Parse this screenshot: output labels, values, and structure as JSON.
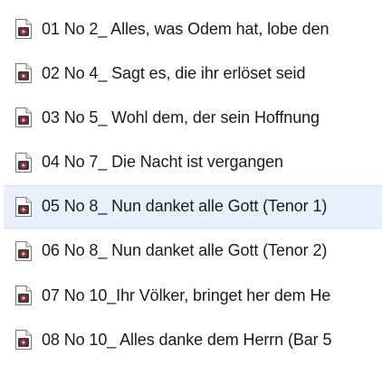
{
  "colors": {
    "selected_bg": "#e8f1fb",
    "text": "#1a1a1a",
    "icon_accent": "#b03030"
  },
  "file_icon": "media-file-icon",
  "files": [
    {
      "name": "01 No 2_ Alles, was Odem hat, lobe den",
      "selected": false
    },
    {
      "name": "02 No 4_ Sagt es, die ihr erlöset seid",
      "selected": false
    },
    {
      "name": "03 No 5_ Wohl dem, der sein Hoffnung",
      "selected": false
    },
    {
      "name": "04 No 7_ Die Nacht ist vergangen",
      "selected": false
    },
    {
      "name": "05 No 8_ Nun danket alle Gott (Tenor 1)",
      "selected": true
    },
    {
      "name": "06 No 8_ Nun danket alle Gott (Tenor 2)",
      "selected": false
    },
    {
      "name": "07 No 10_Ihr Völker, bringet her dem He",
      "selected": false
    },
    {
      "name": "08 No 10_ Alles danke dem Herrn (Bar 5",
      "selected": false
    }
  ]
}
